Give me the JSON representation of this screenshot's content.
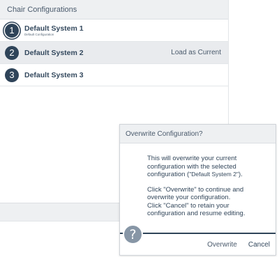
{
  "panel": {
    "title": "Chair Configurations",
    "rows": [
      {
        "number": "1",
        "name": "Default System 1",
        "subtitle": "Default Configuration",
        "action": ""
      },
      {
        "number": "2",
        "name": "Default System 2",
        "subtitle": "",
        "action": "Load as Current"
      },
      {
        "number": "3",
        "name": "Default System 3",
        "subtitle": "",
        "action": ""
      }
    ]
  },
  "dialog": {
    "title": "Overwrite Configuration?",
    "para1_line1": "This will overwrite your current",
    "para1_line2": "configuration with the selected",
    "para1_line3_prefix": "configuration (",
    "para1_line3_quoted": "\"Default System 2\"",
    "para1_line3_suffix": ").",
    "para2_line1": "Click \"Overwrite\" to continue and",
    "para2_line2": "overwrite your configuration.",
    "para2_line3": "Click \"Cancel\" to retain your",
    "para2_line4": "configuration and resume editing.",
    "help_glyph": "?",
    "overwrite_label": "Overwrite",
    "cancel_label": "Cancel"
  },
  "icons": {
    "help": "help-icon"
  },
  "colors": {
    "accent_navy": "#2f4459",
    "header_gray": "#eef0f2",
    "help_icon_gray": "#8796a6"
  }
}
